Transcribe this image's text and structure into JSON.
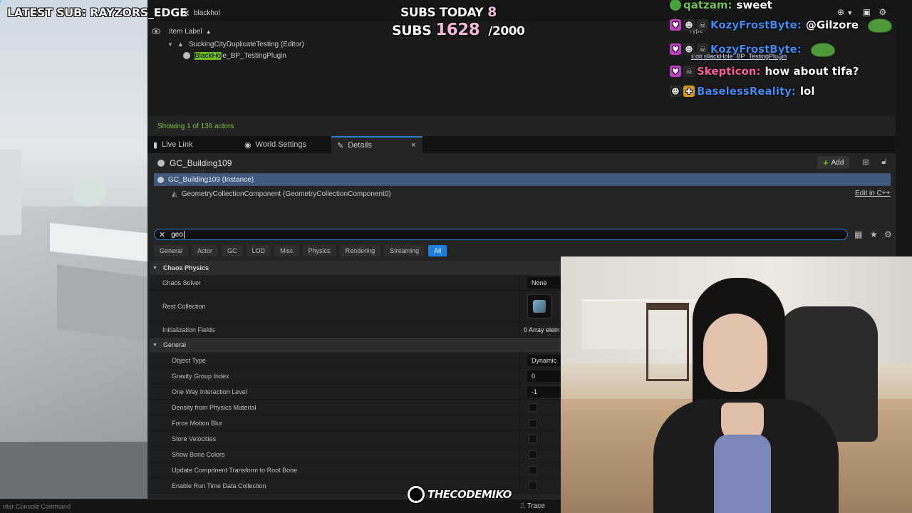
{
  "stream_overlay": {
    "latest_sub": "LATEST SUB: RAYZORS_EDGE",
    "subs_today_label": "SUBS TODAY",
    "subs_today_value": "8",
    "subs_label": "SUBS",
    "subs_value": "1628",
    "subs_goal": "/2000",
    "watermark": "THECODEMIKO",
    "colors": {
      "accent_pink": "#f3b6d8",
      "text": "#ffffff"
    }
  },
  "chat": {
    "messages": [
      {
        "user": "qatzam:",
        "text": "sweet",
        "color": "#6fc24a",
        "badges": [
          "frog-badge"
        ]
      },
      {
        "user": "KozyFrostByte:",
        "text": "@Gilzore",
        "color": "#3b8ef0",
        "badges": [
          "heart-badge",
          "skull-badge",
          "skull-badge"
        ]
      },
      {
        "user": "KozyFrostByte:",
        "text": "",
        "color": "#3b8ef0",
        "badges": [
          "heart-badge",
          "skull-badge",
          "skull-badge"
        ]
      },
      {
        "user": "Skepticon:",
        "text": "how about tifa?",
        "color": "#ff5fa2",
        "badges": [
          "heart-badge",
          "skull-badge"
        ]
      },
      {
        "user": "BaselessReality:",
        "text": "lol",
        "color": "#3b8ef0",
        "badges": [
          "skull-badge",
          "gift-badge"
        ]
      }
    ]
  },
  "editor": {
    "outliner": {
      "search_value": "blackhol",
      "column_header": "Item Label",
      "tree": [
        {
          "label": "SuckingCityDuplicateTesting (Editor)",
          "level": 1
        },
        {
          "label_highlight": "BlackHo",
          "label_rest": "le_BP_TestingPlugin",
          "level": 2
        }
      ],
      "tooltip_type": "Type",
      "tooltip_edit": "Edit BlackHole_BP_TestingPlugin",
      "status": "Showing 1 of 136 actors"
    },
    "tabs": [
      {
        "label": "Live Link",
        "icon": "live-link-icon"
      },
      {
        "label": "World Settings",
        "icon": "globe-icon"
      },
      {
        "label": "Details",
        "icon": "pencil-icon",
        "active": true,
        "close": "×"
      }
    ],
    "details": {
      "actor_name": "GC_Building109",
      "add_label": "Add",
      "instance_label": "GC_Building109 (Instance)",
      "component_label": "GeometryCollectionComponent (GeometryCollectionComponent0)",
      "edit_cpp": "Edit in C++",
      "filter_value": "geo",
      "categories": [
        "General",
        "Actor",
        "GC",
        "LOD",
        "Misc",
        "Physics",
        "Rendering",
        "Streaming",
        "All"
      ],
      "active_category": "All",
      "sections": [
        {
          "title": "Chaos Physics",
          "props": [
            {
              "label": "Chaos Solver",
              "value": "None",
              "kind": "text"
            },
            {
              "label": "Rest Collection",
              "value": "",
              "kind": "thumb"
            },
            {
              "label": "Initialization Fields",
              "value": "0 Array elem",
              "kind": "plain"
            }
          ]
        },
        {
          "title": "General",
          "props": [
            {
              "label": "Object Type",
              "value": "Dynamic",
              "kind": "text"
            },
            {
              "label": "Gravity Group Index",
              "value": "0",
              "kind": "text"
            },
            {
              "label": "One Way Interaction Level",
              "value": "-1",
              "kind": "text"
            },
            {
              "label": "Density from Physics Material",
              "value": "",
              "kind": "check"
            },
            {
              "label": "Force Motion Blur",
              "value": "",
              "kind": "check"
            },
            {
              "label": "Store Velocities",
              "value": "",
              "kind": "check"
            },
            {
              "label": "Show Bone Colors",
              "value": "",
              "kind": "check"
            },
            {
              "label": "Update Component Transform to Root Bone",
              "value": "",
              "kind": "check"
            },
            {
              "label": "Enable Run Time Data Collection",
              "value": "",
              "kind": "check"
            }
          ]
        }
      ]
    },
    "console_placeholder": "nter Console Command",
    "trace_label": "Trace"
  }
}
